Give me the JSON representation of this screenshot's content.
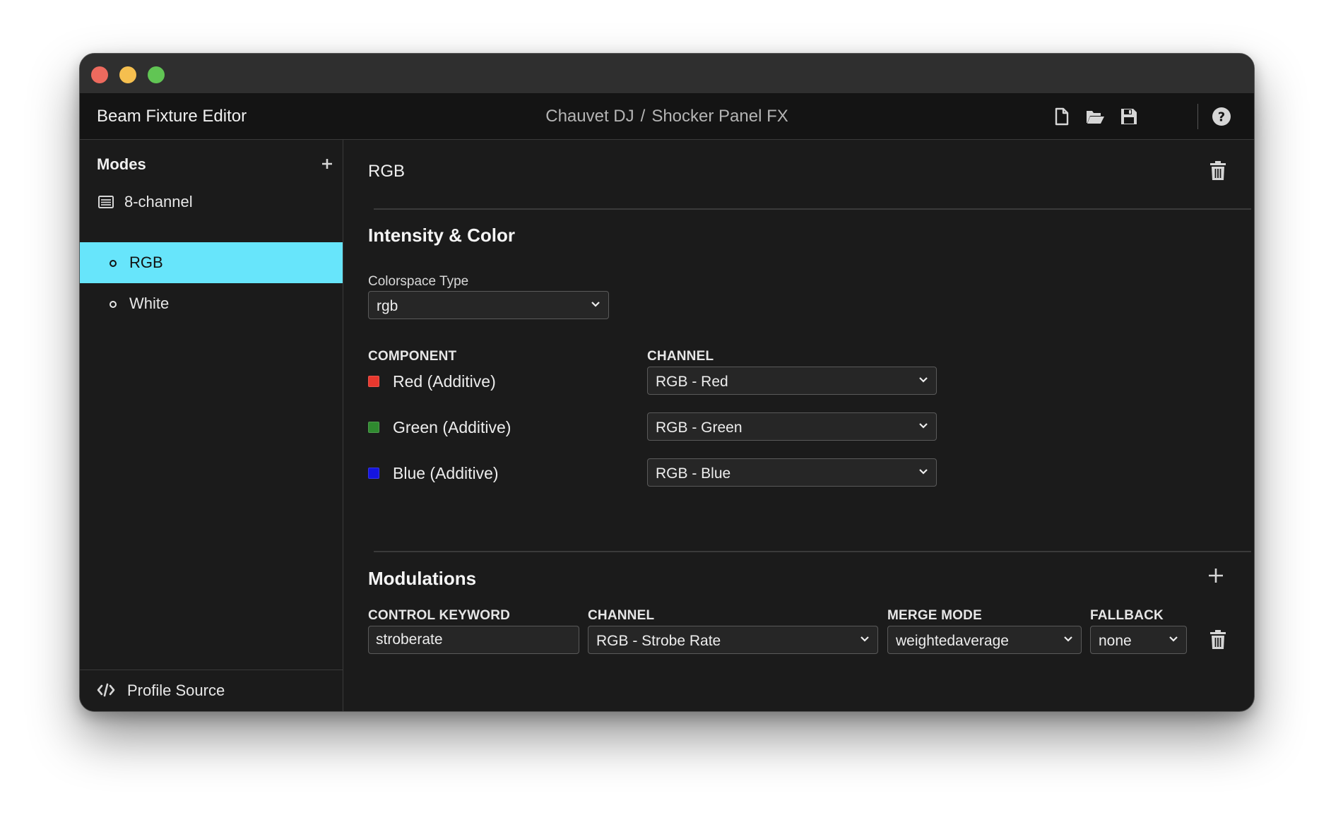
{
  "app": {
    "title": "Beam Fixture Editor",
    "breadcrumb": {
      "manufacturer": "Chauvet DJ",
      "separator": "/",
      "fixture": "Shocker Panel FX"
    }
  },
  "toolbar": {
    "icons": [
      "new-file-icon",
      "open-folder-icon",
      "save-icon",
      "help-icon"
    ]
  },
  "sidebar": {
    "header": "Modes",
    "group": {
      "label": "8-channel",
      "icon": "list-icon"
    },
    "items": [
      {
        "label": "RGB",
        "active": true
      },
      {
        "label": "White",
        "active": false
      }
    ],
    "footer": {
      "label": "Profile Source",
      "icon": "code-icon"
    }
  },
  "main": {
    "mode_title": "RGB",
    "intensity": {
      "title": "Intensity & Color",
      "colorspace_label": "Colorspace Type",
      "colorspace_value": "rgb",
      "headers": {
        "component": "COMPONENT",
        "channel": "CHANNEL"
      },
      "components": [
        {
          "label": "Red (Additive)",
          "color": "#e8382e",
          "channel": "RGB - Red"
        },
        {
          "label": "Green (Additive)",
          "color": "#2f8a2f",
          "channel": "RGB - Green"
        },
        {
          "label": "Blue (Additive)",
          "color": "#1414e0",
          "channel": "RGB - Blue"
        }
      ]
    },
    "modulations": {
      "title": "Modulations",
      "headers": {
        "control_keyword": "CONTROL KEYWORD",
        "channel": "CHANNEL",
        "merge_mode": "MERGE MODE",
        "fallback": "FALLBACK"
      },
      "rows": [
        {
          "keyword": "stroberate",
          "channel": "RGB - Strobe Rate",
          "merge_mode": "weightedaverage",
          "fallback": "none"
        }
      ]
    }
  },
  "colors": {
    "accent": "#67e5fb",
    "background": "#1b1b1b",
    "appbar": "#141414"
  }
}
